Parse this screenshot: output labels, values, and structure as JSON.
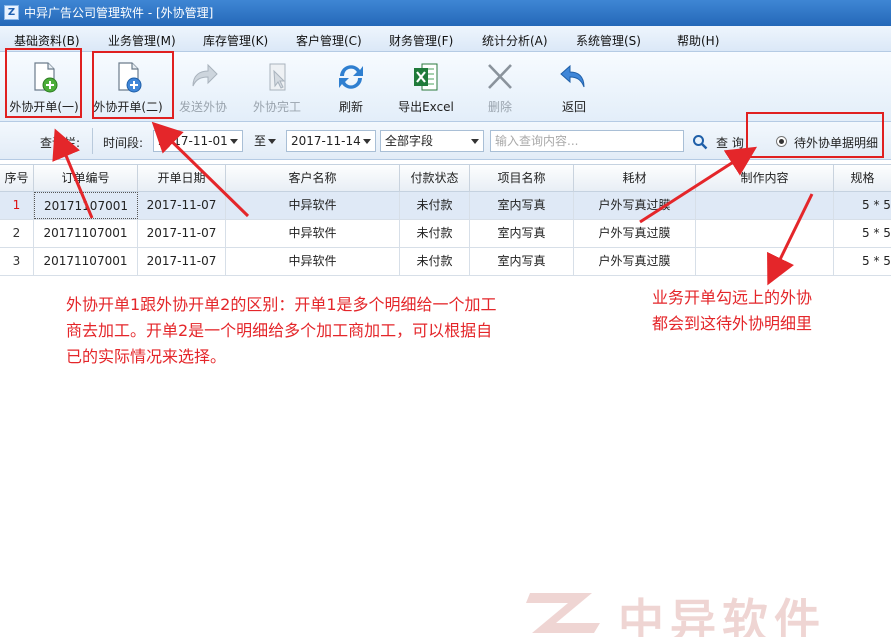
{
  "window": {
    "title": "中异广告公司管理软件 - [外协管理]",
    "logo_glyph": "Z"
  },
  "menu": [
    "基础资料(B)",
    "业务管理(M)",
    "库存管理(K)",
    "客户管理(C)",
    "财务管理(F)",
    "统计分析(A)",
    "系统管理(S)",
    "帮助(H)"
  ],
  "toolbar": {
    "outsource_open_1": "外协开单(一)",
    "outsource_open_2": "外协开单(二)",
    "send_outsource": "发送外协",
    "outsource_done": "外协完工",
    "refresh": "刷新",
    "export_excel": "导出Excel",
    "delete": "删除",
    "back": "返回"
  },
  "query": {
    "bar_label": "查询栏:",
    "period_label": "时间段:",
    "date_from": "2017-11-01",
    "to_label": "至",
    "date_to": "2017-11-14",
    "field_select": "全部字段",
    "search_placeholder": "输入查询内容...",
    "search_button": "查 询",
    "pending_detail": "待外协单据明细"
  },
  "grid": {
    "columns": [
      "序号",
      "订单编号",
      "开单日期",
      "客户名称",
      "付款状态",
      "项目名称",
      "耗材",
      "制作内容",
      "规格"
    ],
    "rows": [
      {
        "idx": "1",
        "order_no": "20171107001",
        "date": "2017-11-07",
        "customer": "中异软件",
        "pay_status": "未付款",
        "project": "室内写真",
        "material": "户外写真过膜",
        "content": "",
        "spec": "5 * 5"
      },
      {
        "idx": "2",
        "order_no": "20171107001",
        "date": "2017-11-07",
        "customer": "中异软件",
        "pay_status": "未付款",
        "project": "室内写真",
        "material": "户外写真过膜",
        "content": "",
        "spec": "5 * 5"
      },
      {
        "idx": "3",
        "order_no": "20171107001",
        "date": "2017-11-07",
        "customer": "中异软件",
        "pay_status": "未付款",
        "project": "室内写真",
        "material": "户外写真过膜",
        "content": "",
        "spec": "5 * 5"
      }
    ]
  },
  "annotations": {
    "left_note": [
      "外协开单1跟外协开单2的区别：开单1是多个明细给一个加工",
      "商去加工。开单2是一个明细给多个加工商加工，可以根据自",
      "已的实际情况来选择。"
    ],
    "right_note": [
      "业务开单勾远上的外协",
      "都会到这待外协明细里"
    ],
    "color": "#e4262a"
  },
  "watermark": {
    "text": "中异软件"
  }
}
